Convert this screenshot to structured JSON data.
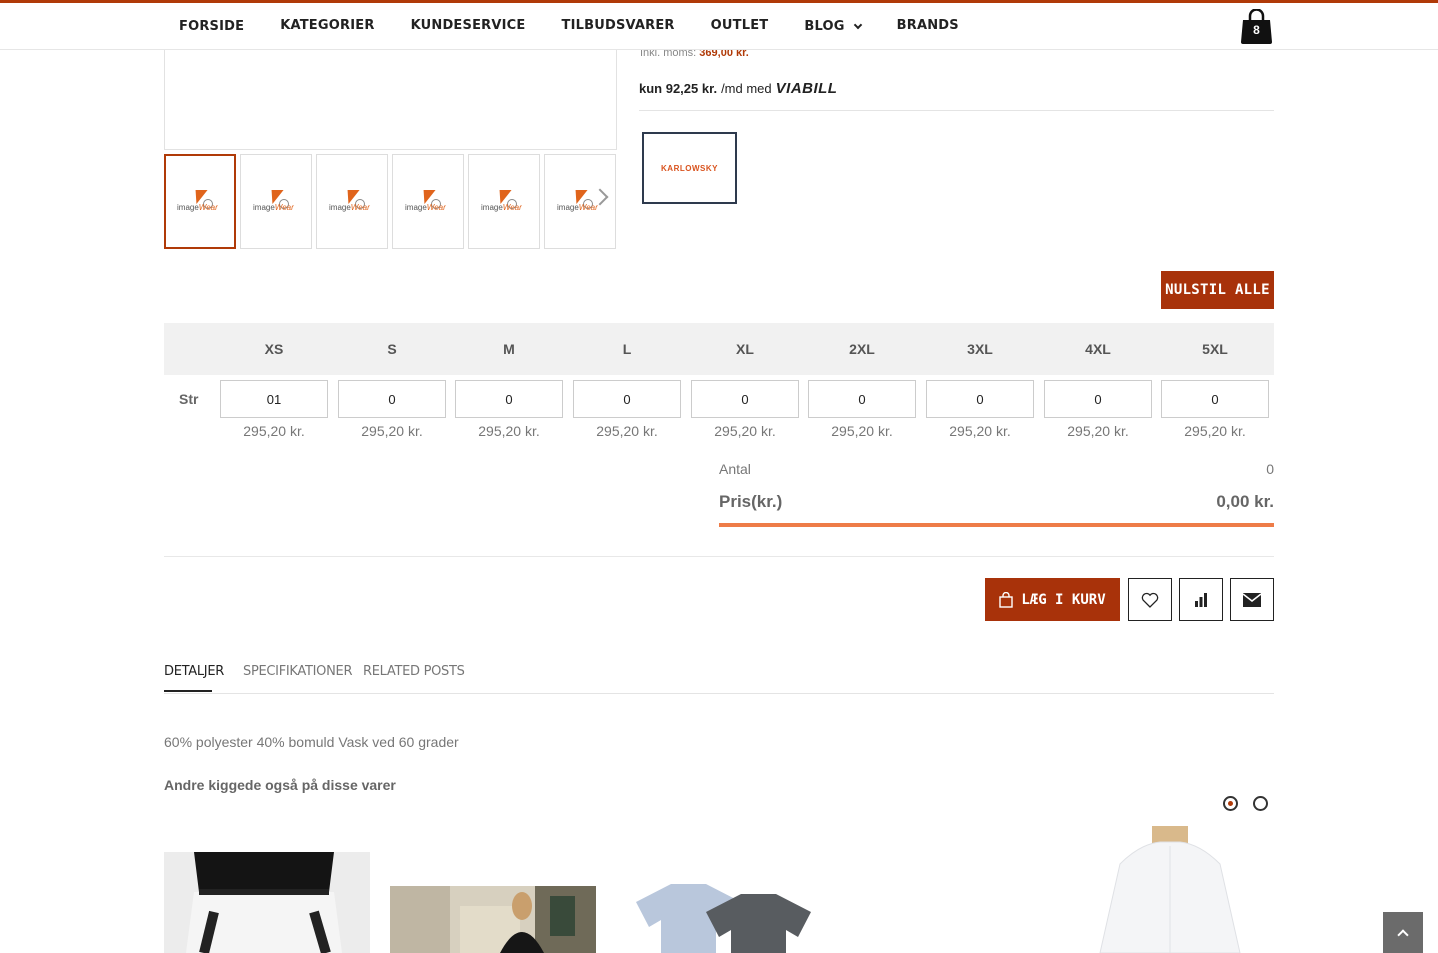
{
  "nav": {
    "items": [
      {
        "label": "FORSIDE"
      },
      {
        "label": "KATEGORIER"
      },
      {
        "label": "KUNDESERVICE"
      },
      {
        "label": "TILBUDSVARER"
      },
      {
        "label": "OUTLET"
      },
      {
        "label": "BLOG",
        "has_dropdown": true
      },
      {
        "label": "BRANDS"
      }
    ],
    "cart_count": "8"
  },
  "gallery": {
    "thumb_logo_text_a": "image",
    "thumb_logo_text_b": "Wear",
    "thumb_count": 6
  },
  "price": {
    "vat_label": "Inkl. moms:",
    "vat_amount": "369,00 kr.",
    "viabill_kun": "kun 92,25 kr.",
    "viabill_text": "/md med",
    "viabill_brand": "VIABILL"
  },
  "brand_logo": "KARLOWSKY",
  "reset_label": "NULSTIL ALLE",
  "sizes": {
    "row_label": "Str",
    "columns": [
      {
        "size": "XS",
        "qty": "01",
        "price": "295,20 kr."
      },
      {
        "size": "S",
        "qty": "0",
        "price": "295,20 kr."
      },
      {
        "size": "M",
        "qty": "0",
        "price": "295,20 kr."
      },
      {
        "size": "L",
        "qty": "0",
        "price": "295,20 kr."
      },
      {
        "size": "XL",
        "qty": "0",
        "price": "295,20 kr."
      },
      {
        "size": "2XL",
        "qty": "0",
        "price": "295,20 kr."
      },
      {
        "size": "3XL",
        "qty": "0",
        "price": "295,20 kr."
      },
      {
        "size": "4XL",
        "qty": "0",
        "price": "295,20 kr."
      },
      {
        "size": "5XL",
        "qty": "0",
        "price": "295,20 kr."
      }
    ]
  },
  "totals": {
    "antal_label": "Antal",
    "antal_value": "0",
    "price_label": "Pris(kr.)",
    "price_value": "0,00 kr."
  },
  "actions": {
    "add_to_cart": "LÆG I KURV",
    "wishlist_icon": "heart-icon",
    "compare_icon": "bar-chart-icon",
    "email_icon": "envelope-icon"
  },
  "tabs": [
    {
      "label": "DETALJER",
      "active": true
    },
    {
      "label": "SPECIFIKATIONER",
      "active": false
    },
    {
      "label": "RELATED POSTS",
      "active": false
    }
  ],
  "description": "60% polyester 40% bomuld Vask ved 60 grader",
  "also_viewed_title": "Andre kiggede også på disse varer",
  "colors": {
    "accent": "#a8320a",
    "bar": "#ee7c48"
  }
}
